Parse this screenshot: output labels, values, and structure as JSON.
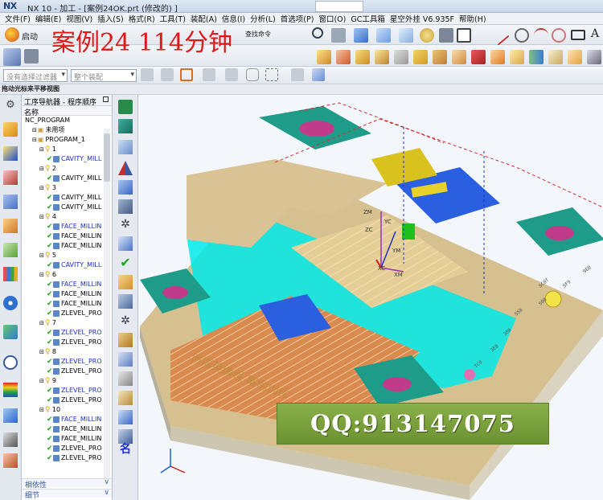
{
  "app": {
    "logo": "NX",
    "title": "NX 10 - 加工 - [案例24OK.prt  (修改的) ]"
  },
  "menu": [
    "文件(F)",
    "编辑(E)",
    "视图(V)",
    "插入(S)",
    "格式(R)",
    "工具(T)",
    "装配(A)",
    "信息(I)",
    "分析(L)",
    "首选项(P)",
    "窗口(O)",
    "GC工具箱",
    "星空外挂 V6.935F",
    "帮助(H)"
  ],
  "toolbar": {
    "start_label": "启动",
    "find_label": "查找命令",
    "filter_placeholder": "没有选择过滤器",
    "assembly_placeholder": "整个装配"
  },
  "overlay": {
    "title": "案例24    114分钟",
    "qq": "QQ:913147075"
  },
  "statusbar": "拖动光标来平移视图",
  "navigator": {
    "title": "工序导航器 - 程序顺序",
    "column": "名称",
    "rows": [
      {
        "text": "NC_PROGRAM",
        "indent": 0,
        "kind": "root",
        "blue": false
      },
      {
        "text": "未用项",
        "indent": 1,
        "kind": "folder",
        "blue": false
      },
      {
        "text": "PROGRAM_1",
        "indent": 1,
        "kind": "folder",
        "blue": false
      },
      {
        "text": "1",
        "indent": 2,
        "kind": "group",
        "blue": false
      },
      {
        "text": "CAVITY_MILL",
        "indent": 3,
        "kind": "op",
        "blue": true
      },
      {
        "text": "2",
        "indent": 2,
        "kind": "group",
        "blue": false
      },
      {
        "text": "CAVITY_MILL",
        "indent": 3,
        "kind": "op",
        "blue": false
      },
      {
        "text": "3",
        "indent": 2,
        "kind": "group",
        "blue": false
      },
      {
        "text": "CAVITY_MILL",
        "indent": 3,
        "kind": "op",
        "blue": false
      },
      {
        "text": "CAVITY_MILL",
        "indent": 3,
        "kind": "op",
        "blue": false
      },
      {
        "text": "4",
        "indent": 2,
        "kind": "group",
        "blue": false
      },
      {
        "text": "FACE_MILLIN",
        "indent": 3,
        "kind": "op",
        "blue": true
      },
      {
        "text": "FACE_MILLIN",
        "indent": 3,
        "kind": "op",
        "blue": false
      },
      {
        "text": "FACE_MILLIN",
        "indent": 3,
        "kind": "op",
        "blue": false
      },
      {
        "text": "5",
        "indent": 2,
        "kind": "group",
        "blue": false
      },
      {
        "text": "CAVITY_MILL",
        "indent": 3,
        "kind": "op",
        "blue": true
      },
      {
        "text": "6",
        "indent": 2,
        "kind": "group",
        "blue": false
      },
      {
        "text": "FACE_MILLIN",
        "indent": 3,
        "kind": "op",
        "blue": true
      },
      {
        "text": "FACE_MILLIN",
        "indent": 3,
        "kind": "op",
        "blue": false
      },
      {
        "text": "FACE_MILLIN",
        "indent": 3,
        "kind": "op",
        "blue": false
      },
      {
        "text": "ZLEVEL_PRO",
        "indent": 3,
        "kind": "op",
        "blue": false
      },
      {
        "text": "7",
        "indent": 2,
        "kind": "group",
        "blue": false
      },
      {
        "text": "ZLEVEL_PRO",
        "indent": 3,
        "kind": "op",
        "blue": true
      },
      {
        "text": "ZLEVEL_PRO",
        "indent": 3,
        "kind": "op",
        "blue": false
      },
      {
        "text": "8",
        "indent": 2,
        "kind": "group",
        "blue": false
      },
      {
        "text": "ZLEVEL_PRO",
        "indent": 3,
        "kind": "op",
        "blue": true
      },
      {
        "text": "ZLEVEL_PRO",
        "indent": 3,
        "kind": "op",
        "blue": false
      },
      {
        "text": "9",
        "indent": 2,
        "kind": "group",
        "blue": false
      },
      {
        "text": "ZLEVEL_PRO",
        "indent": 3,
        "kind": "op",
        "blue": true
      },
      {
        "text": "ZLEVEL_PRO",
        "indent": 3,
        "kind": "op",
        "blue": false
      },
      {
        "text": "10",
        "indent": 2,
        "kind": "group",
        "blue": false
      },
      {
        "text": "FACE_MILLIN",
        "indent": 3,
        "kind": "op",
        "blue": true
      },
      {
        "text": "FACE_MILLIN",
        "indent": 3,
        "kind": "op",
        "blue": false
      },
      {
        "text": "FACE_MILLIN",
        "indent": 3,
        "kind": "op",
        "blue": false
      },
      {
        "text": "ZLEVEL_PRO",
        "indent": 3,
        "kind": "op",
        "blue": false
      },
      {
        "text": "ZLEVEL_PRO",
        "indent": 3,
        "kind": "op",
        "blue": false
      }
    ],
    "dependency": "相依性",
    "details": "细节"
  },
  "part": {
    "engraving": "何振英编程 案例训练",
    "axis_labels": [
      "ZM",
      "YC",
      "ZC",
      "XC",
      "XM",
      "YM"
    ],
    "side_labels": [
      "SC0T",
      "SS0",
      "S00",
      "SF9",
      "3E0",
      "9E0",
      "TC0",
      "300"
    ]
  },
  "colors": {
    "part_top": "#d6c08f",
    "part_side": "#c9c4b3",
    "toolpath": "#00f0f0",
    "copper": "#d98a4e",
    "blue_pocket": "#2a5fe0",
    "teal_pad": "#1f9b8a",
    "title_red": "#e01818",
    "qq_green": "#7ba23c"
  }
}
